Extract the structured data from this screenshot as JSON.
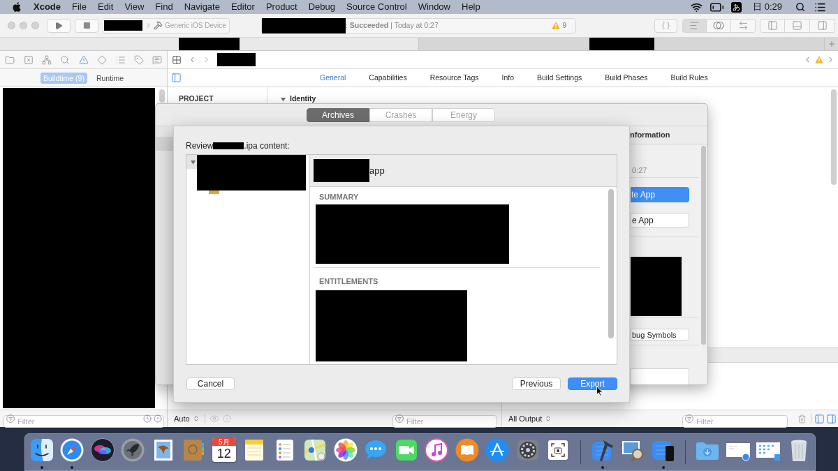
{
  "menu_bar": {
    "app_name": "Xcode",
    "menus": [
      "File",
      "Edit",
      "View",
      "Find",
      "Navigate",
      "Editor",
      "Product",
      "Debug",
      "Source Control",
      "Window",
      "Help"
    ],
    "input_source": "あ",
    "clock": "日 0:29"
  },
  "toolbar": {
    "destination": "Generic iOS Device",
    "activity": ": **Succeeded** | Today at 0:27",
    "warning_count": "9",
    "editor_modes": [
      {
        "kind": "standard",
        "selected": true
      },
      {
        "kind": "assistant",
        "selected": false
      },
      {
        "kind": "version",
        "selected": false
      }
    ],
    "panels": [
      {
        "kind": "navigator"
      },
      {
        "kind": "debug"
      },
      {
        "kind": "inspector"
      }
    ]
  },
  "window_tabs": [
    {
      "selected": true
    },
    {
      "selected": false
    }
  ],
  "navigator": {
    "tabs": [
      {
        "kind": "project",
        "selected": false
      },
      {
        "kind": "source_control",
        "selected": false
      },
      {
        "kind": "symbol",
        "selected": false
      },
      {
        "kind": "find",
        "selected": false
      },
      {
        "kind": "issue",
        "selected": true
      },
      {
        "kind": "test",
        "selected": false
      },
      {
        "kind": "debug",
        "selected": false
      },
      {
        "kind": "breakpoint",
        "selected": false
      },
      {
        "kind": "report",
        "selected": false
      }
    ],
    "scopes": [
      {
        "label": "Buildtime (9)",
        "selected": true
      },
      {
        "label": "Runtime",
        "selected": false
      }
    ],
    "filter_placeholder": "Filter"
  },
  "editor": {
    "tabs": [
      {
        "label": "General",
        "selected": true
      },
      {
        "label": "Capabilities",
        "selected": false
      },
      {
        "label": "Resource Tags",
        "selected": false
      },
      {
        "label": "Info",
        "selected": false
      },
      {
        "label": "Build Settings",
        "selected": false
      },
      {
        "label": "Build Phases",
        "selected": false
      },
      {
        "label": "Build Rules",
        "selected": false
      }
    ],
    "project_header": "PROJECT",
    "section": {
      "title": "Identity",
      "expanded": true
    }
  },
  "organizer": {
    "segments": [
      {
        "label": "Archives",
        "selected": true
      },
      {
        "label": "Crashes",
        "selected": false
      },
      {
        "label": "Energy",
        "selected": false
      }
    ],
    "inspector": {
      "header": "nformation",
      "date": "0:27",
      "buttons": [
        {
          "label": "te App",
          "kind": "primary"
        },
        {
          "label": "e App",
          "kind": "secondary"
        },
        {
          "label": "bug Symbols",
          "kind": "secondary"
        }
      ]
    }
  },
  "export_sheet": {
    "prompt_prefix": "Review",
    "prompt_suffix": ".ipa content:",
    "tree_expanded": true,
    "app_suffix": "app",
    "sections": [
      {
        "title": "SUMMARY"
      },
      {
        "title": "ENTITLEMENTS"
      }
    ],
    "buttons": [
      {
        "label": "Cancel",
        "kind": "secondary"
      },
      {
        "label": "Previous",
        "kind": "secondary"
      },
      {
        "label": "Export",
        "kind": "primary"
      }
    ]
  },
  "debug_bar": {
    "scope": "Auto",
    "variables_filter_placeholder": "Filter",
    "output": "All Output",
    "console_filter_placeholder": "Filter",
    "panes": [
      {
        "kind": "variables",
        "on": true
      },
      {
        "kind": "console",
        "on": true
      }
    ]
  },
  "dock": {
    "items": [
      {
        "kind": "finder",
        "running": true
      },
      {
        "kind": "safari",
        "running": true
      },
      {
        "kind": "siri",
        "running": false
      },
      {
        "kind": "launchpad",
        "running": false
      },
      {
        "kind": "mail",
        "running": false
      },
      {
        "kind": "contacts",
        "running": false
      },
      {
        "kind": "calendar",
        "running": false,
        "month": "5月",
        "day": "12"
      },
      {
        "kind": "notes",
        "running": false
      },
      {
        "kind": "reminders",
        "running": false
      },
      {
        "kind": "maps",
        "running": false
      },
      {
        "kind": "photos",
        "running": false
      },
      {
        "kind": "messages",
        "running": false
      },
      {
        "kind": "facetime",
        "running": false
      },
      {
        "kind": "itunes",
        "running": false
      },
      {
        "kind": "books",
        "running": false
      },
      {
        "kind": "app_store",
        "running": false
      },
      {
        "kind": "system_preferences",
        "running": false
      },
      {
        "kind": "screenshot",
        "running": false
      },
      {
        "kind": "separator"
      },
      {
        "kind": "xcode",
        "running": true
      },
      {
        "kind": "preview",
        "running": false
      },
      {
        "kind": "simulator",
        "running": true
      },
      {
        "kind": "separator"
      },
      {
        "kind": "downloads",
        "running": false
      },
      {
        "kind": "window_browser",
        "running": false
      },
      {
        "kind": "window_files",
        "running": false
      },
      {
        "kind": "trash",
        "running": false
      }
    ]
  }
}
